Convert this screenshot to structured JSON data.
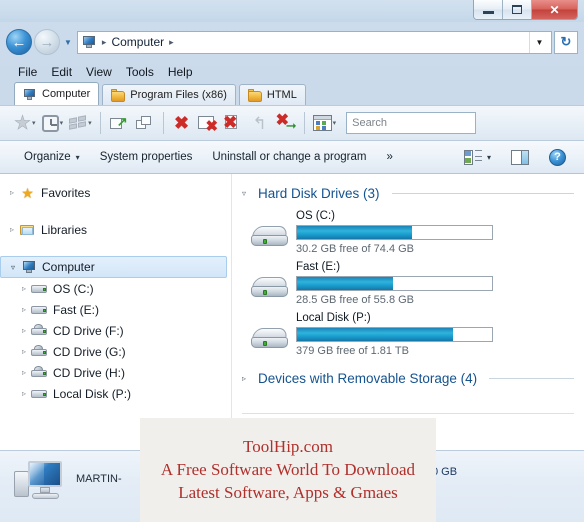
{
  "window": {
    "controls": {
      "minimize": "minimize-button",
      "maximize": "maximize-button",
      "close_label": "✕"
    }
  },
  "address_bar": {
    "back_glyph": "←",
    "forward_glyph": "→",
    "history_glyph": "▼",
    "breadcrumb": [
      "Computer"
    ],
    "separator": "▸",
    "dropdown_glyph": "▼",
    "refresh_glyph": "↻"
  },
  "menu": {
    "items": [
      "File",
      "Edit",
      "View",
      "Tools",
      "Help"
    ]
  },
  "tabs": [
    {
      "label": "Computer",
      "icon": "monitor-icon",
      "active": true
    },
    {
      "label": "Program Files (x86)",
      "icon": "folder-icon",
      "active": false
    },
    {
      "label": "HTML",
      "icon": "folder-icon",
      "active": false
    }
  ],
  "toolbar": {
    "buttons": [
      {
        "name": "favorites-button",
        "icon": "star-icon",
        "caret": "▾"
      },
      {
        "name": "history-button",
        "icon": "clock-icon",
        "caret": "▾"
      },
      {
        "name": "windows-button",
        "icon": "windows-icon",
        "caret": "▾"
      },
      {
        "name": "open-new-window-button",
        "icon": "window-arrow-icon"
      },
      {
        "name": "duplicate-window-button",
        "icon": "two-windows-icon"
      },
      {
        "name": "close-button",
        "icon": "red-x-icon"
      },
      {
        "name": "close-window-button",
        "icon": "window-x-icon"
      },
      {
        "name": "close-page-button",
        "icon": "page-x-icon"
      },
      {
        "name": "undo-close-button",
        "icon": "undo-icon"
      },
      {
        "name": "close-and-go-button",
        "icon": "x-arrow-icon"
      },
      {
        "name": "views-button",
        "icon": "views-icon",
        "caret": "▾"
      }
    ],
    "caret": "▾",
    "search": {
      "placeholder": "Search",
      "value": ""
    }
  },
  "command_bar": {
    "organize": "Organize",
    "system_properties": "System properties",
    "uninstall": "Uninstall or change a program",
    "overflow": "»",
    "caret": "▾",
    "layout_icon": "layout-icon",
    "preview_pane_icon": "preview-pane-icon",
    "help_icon": "help-icon",
    "help_label": "?"
  },
  "nav_pane": {
    "groups": [
      {
        "label": "Favorites",
        "icon": "star-icon",
        "triangle": "▹",
        "expanded": false,
        "children": []
      },
      {
        "label": "Libraries",
        "icon": "library-icon",
        "triangle": "▹",
        "expanded": false,
        "children": []
      },
      {
        "label": "Computer",
        "icon": "computer-icon",
        "triangle": "▿",
        "expanded": true,
        "selected": true,
        "children": [
          {
            "label": "OS (C:)",
            "icon": "hard-drive-icon",
            "triangle": "▹"
          },
          {
            "label": "Fast (E:)",
            "icon": "hard-drive-icon",
            "triangle": "▹"
          },
          {
            "label": "CD Drive (F:)",
            "icon": "cd-drive-icon",
            "triangle": "▹"
          },
          {
            "label": "CD Drive (G:)",
            "icon": "cd-drive-icon",
            "triangle": "▹"
          },
          {
            "label": "CD Drive (H:)",
            "icon": "cd-drive-icon",
            "triangle": "▹"
          },
          {
            "label": "Local Disk (P:)",
            "icon": "hard-drive-icon",
            "triangle": "▹"
          }
        ]
      }
    ]
  },
  "content": {
    "groups": [
      {
        "title": "Hard Disk Drives (3)",
        "triangle": "▿",
        "expanded": true,
        "drives": [
          {
            "name": "OS (C:)",
            "free_text": "30.2 GB free of 74.4 GB",
            "free_gb": 30.2,
            "total_gb": 74.4,
            "used_percent": 59
          },
          {
            "name": "Fast (E:)",
            "free_text": "28.5 GB free of 55.8 GB",
            "free_gb": 28.5,
            "total_gb": 55.8,
            "used_percent": 49
          },
          {
            "name": "Local Disk (P:)",
            "free_text": "379 GB free of 1.81 TB",
            "free_gb": 379,
            "total_gb": 1853,
            "used_percent": 80
          }
        ]
      },
      {
        "title": "Devices with Removable Storage (4)",
        "triangle": "▹",
        "expanded": false,
        "drives": []
      }
    ]
  },
  "status_bar": {
    "computer_name": "MARTIN-",
    "detail": "0 GB",
    "icon": "computer-icon"
  },
  "watermark": {
    "line1": "ToolHip.com",
    "line2": "A Free Software World To Download",
    "line3": "Latest Software, Apps & Gmaes",
    "color": "#b0302c"
  },
  "colors": {
    "accent_blue": "#15538f",
    "bar_fill": "#1ba0d0",
    "chrome": "#c5d6e8",
    "close_red": "#c4423c",
    "selection": "#d2e6f8"
  }
}
